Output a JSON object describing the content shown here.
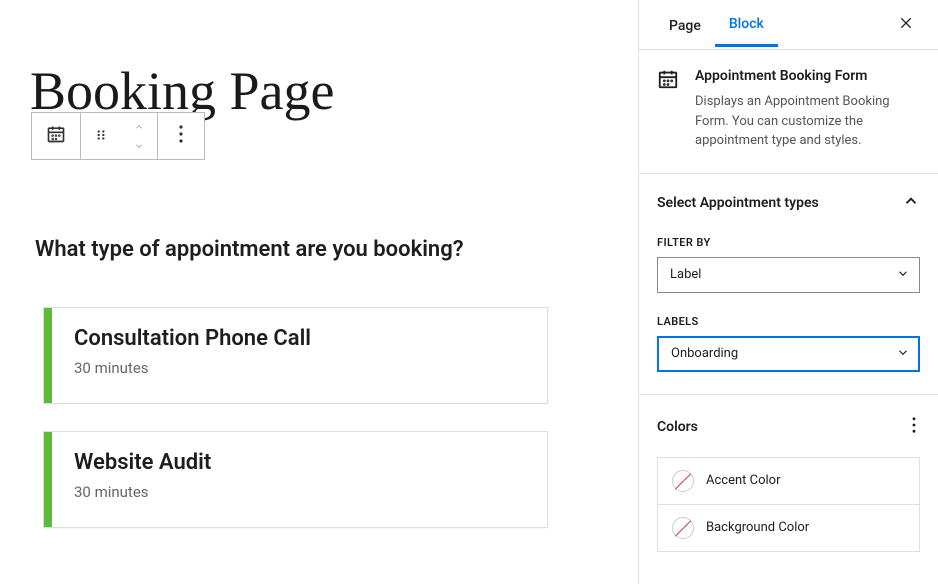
{
  "page": {
    "title": "Booking Page"
  },
  "booking": {
    "question": "What type of appointment are you booking?",
    "appointments": [
      {
        "title": "Consultation Phone Call",
        "duration": "30 minutes"
      },
      {
        "title": "Website Audit",
        "duration": "30 minutes"
      }
    ]
  },
  "sidebar": {
    "tabs": {
      "page": "Page",
      "block": "Block"
    },
    "block_info": {
      "title": "Appointment Booking Form",
      "description": "Displays an Appointment Booking Form. You can customize the appointment type and styles."
    },
    "sections": {
      "appointment_types": {
        "title": "Select Appointment types",
        "filter_by_label": "FILTER BY",
        "filter_by_value": "Label",
        "labels_label": "LABELS",
        "labels_value": "Onboarding"
      },
      "colors": {
        "title": "Colors",
        "items": [
          {
            "label": "Accent Color"
          },
          {
            "label": "Background Color"
          }
        ]
      }
    }
  },
  "colors": {
    "accent": "#5dba3b",
    "primary": "#0073e6"
  }
}
